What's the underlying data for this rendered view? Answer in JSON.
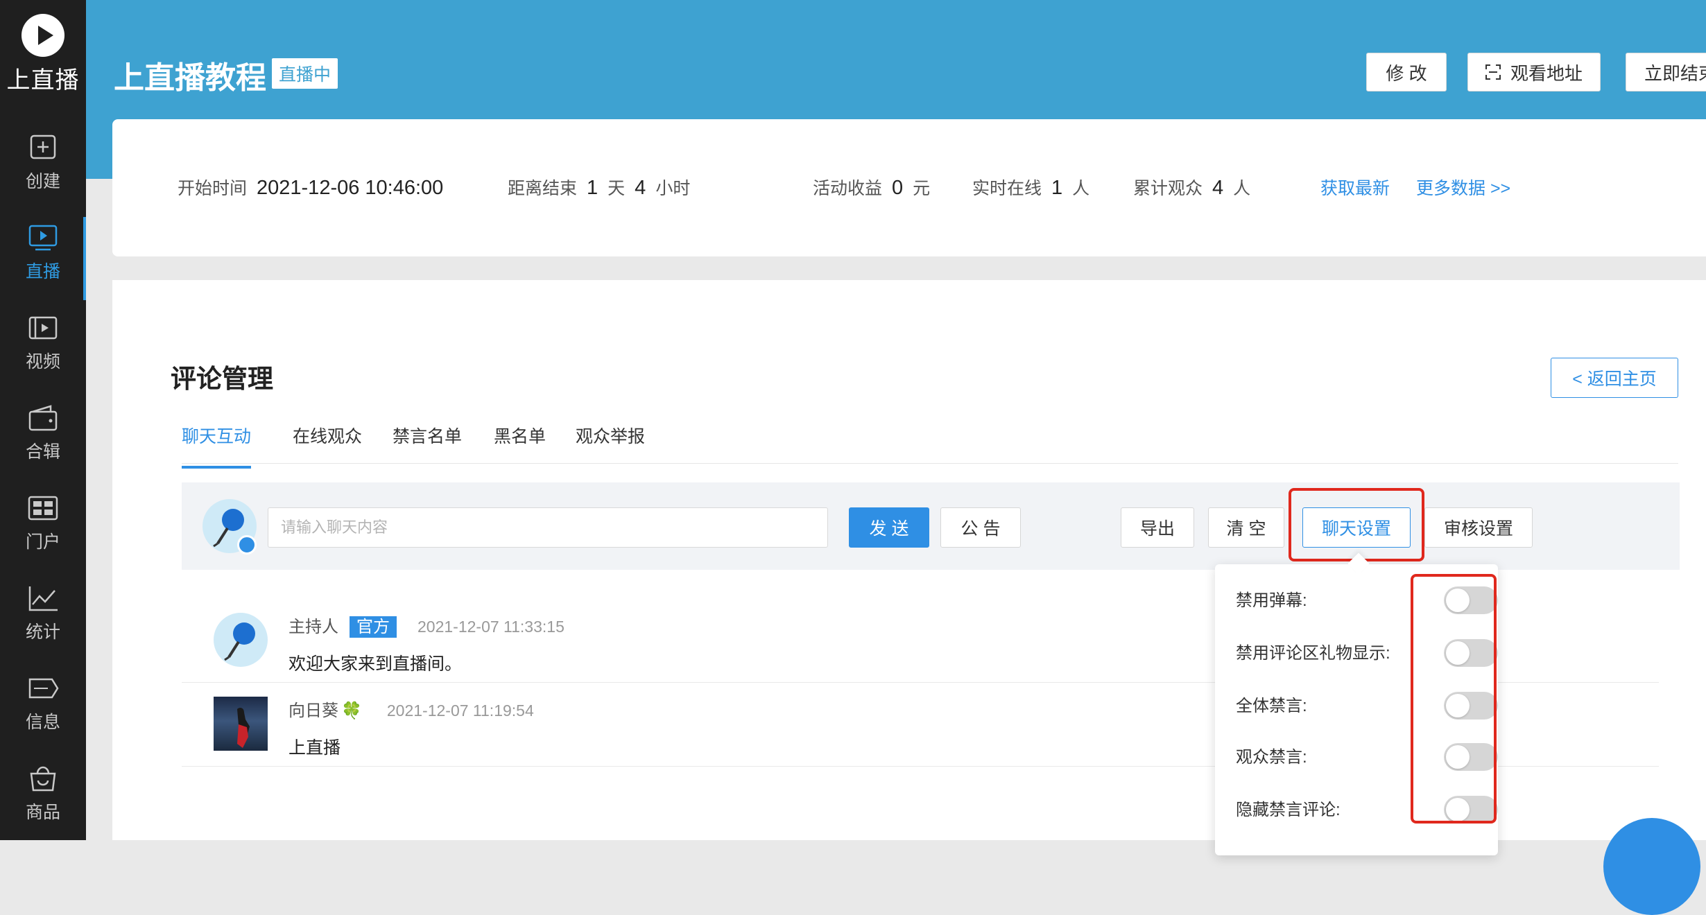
{
  "sidebar": {
    "logo_text": "上直播",
    "items": [
      {
        "label": "创建",
        "icon": "plus-square-icon",
        "active": false
      },
      {
        "label": "直播",
        "icon": "play-screen-icon",
        "active": true
      },
      {
        "label": "视频",
        "icon": "film-icon",
        "active": false
      },
      {
        "label": "合辑",
        "icon": "wallet-icon",
        "active": false
      },
      {
        "label": "门户",
        "icon": "grid-icon",
        "active": false
      },
      {
        "label": "统计",
        "icon": "line-chart-icon",
        "active": false
      },
      {
        "label": "信息",
        "icon": "ticket-icon",
        "active": false
      },
      {
        "label": "商品",
        "icon": "shopping-bag-icon",
        "active": false
      }
    ]
  },
  "header": {
    "title": "上直播教程",
    "live_badge": "直播中",
    "buttons": {
      "edit": "修 改",
      "watch_url": "观看地址",
      "end_now": "立即结束"
    }
  },
  "stats": {
    "start_time_label": "开始时间",
    "start_time": "2021-12-06 10:46:00",
    "remain_label": "距离结束",
    "remain_days": "1",
    "days_unit": "天",
    "remain_hours": "4",
    "hours_unit": "小时",
    "income_label": "活动收益",
    "income": "0",
    "income_unit": "元",
    "online_label": "实时在线",
    "online": "1",
    "online_unit": "人",
    "total_label": "累计观众",
    "total": "4",
    "total_unit": "人",
    "refresh_link": "获取最新",
    "more_link": "更多数据 >>"
  },
  "section": {
    "title": "评论管理",
    "back_button": "< 返回主页",
    "tabs": [
      "聊天互动",
      "在线观众",
      "禁言名单",
      "黑名单",
      "观众举报"
    ]
  },
  "toolbar": {
    "input_placeholder": "请输入聊天内容",
    "send": "发 送",
    "notice": "公 告",
    "export": "导出",
    "clear": "清 空",
    "chat_settings": "聊天设置",
    "review_settings": "审核设置"
  },
  "messages": [
    {
      "user": "主持人",
      "badge": "官方",
      "time": "2021-12-07 11:33:15",
      "text": "欢迎大家来到直播间。"
    },
    {
      "user": "向日葵",
      "emoji": "🍀",
      "time": "2021-12-07 11:19:54",
      "text": "上直播"
    }
  ],
  "chat_settings_menu": [
    {
      "label": "禁用弹幕:",
      "enabled": false
    },
    {
      "label": "禁用评论区礼物显示:",
      "enabled": false
    },
    {
      "label": "全体禁言:",
      "enabled": false
    },
    {
      "label": "观众禁言:",
      "enabled": false
    },
    {
      "label": "隐藏禁言评论:",
      "enabled": false
    }
  ],
  "colors": {
    "header": "#3ea2d1",
    "accent": "#2f8fe4",
    "sidebar": "#1f1f1f",
    "highlight": "#e0281d"
  }
}
